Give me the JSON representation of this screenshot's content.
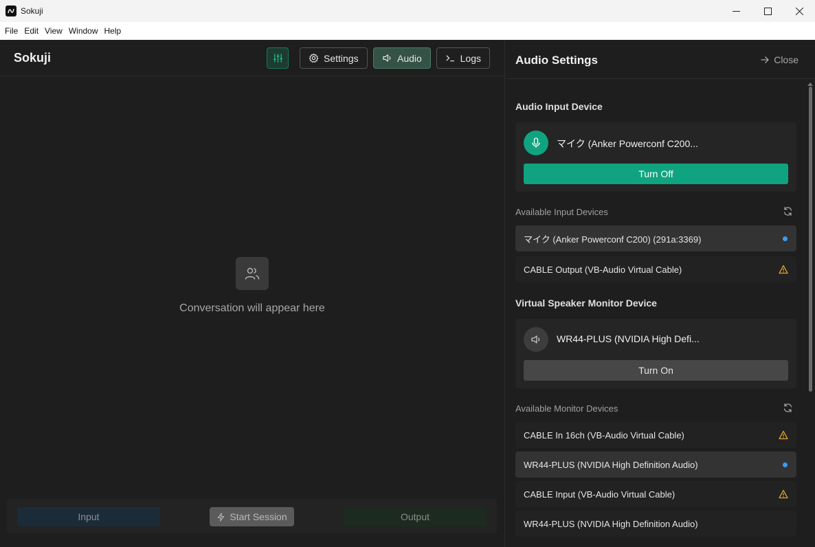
{
  "window": {
    "title": "Sokuji"
  },
  "menu": [
    "File",
    "Edit",
    "View",
    "Window",
    "Help"
  ],
  "header": {
    "brand": "Sokuji",
    "settings_label": "Settings",
    "audio_label": "Audio",
    "logs_label": "Logs"
  },
  "main": {
    "empty_text": "Conversation will appear here",
    "input_label": "Input",
    "start_label": "Start Session",
    "output_label": "Output"
  },
  "panel": {
    "title": "Audio Settings",
    "close_label": "Close",
    "input_device_title": "Audio Input Device",
    "input_device_name": "マイク (Anker Powerconf C200...",
    "input_toggle_label": "Turn Off",
    "available_inputs_title": "Available Input Devices",
    "input_devices": [
      {
        "name": "マイク (Anker Powerconf C200) (291a:3369)",
        "status": "selected"
      },
      {
        "name": "CABLE Output (VB-Audio Virtual Cable)",
        "status": "warning"
      }
    ],
    "monitor_title": "Virtual Speaker Monitor Device",
    "monitor_device_name": "WR44-PLUS (NVIDIA High Defi...",
    "monitor_toggle_label": "Turn On",
    "available_monitors_title": "Available Monitor Devices",
    "monitor_devices": [
      {
        "name": "CABLE In 16ch (VB-Audio Virtual Cable)",
        "status": "warning"
      },
      {
        "name": "WR44-PLUS (NVIDIA High Definition Audio)",
        "status": "selected"
      },
      {
        "name": "CABLE Input (VB-Audio Virtual Cable)",
        "status": "warning"
      },
      {
        "name": "WR44-PLUS (NVIDIA High Definition Audio)",
        "status": "none"
      }
    ]
  },
  "colors": {
    "accent_green": "#10a37f",
    "selected_dot": "#3b9bf2",
    "warning": "#e5a92b"
  }
}
